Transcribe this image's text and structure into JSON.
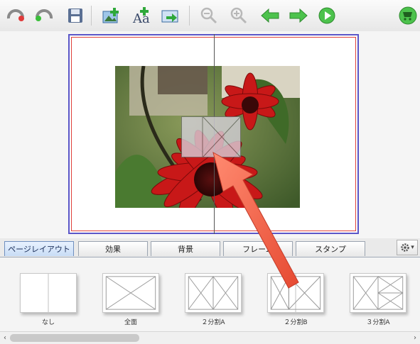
{
  "toolbar": {
    "buttons": [
      {
        "icon": "undo-icon"
      },
      {
        "icon": "redo-icon"
      },
      {
        "icon": "save-icon"
      },
      {
        "icon": "add-photo-icon"
      },
      {
        "icon": "add-text-icon"
      },
      {
        "icon": "add-image-icon"
      },
      {
        "icon": "zoom-out-icon"
      },
      {
        "icon": "zoom-in-icon"
      },
      {
        "icon": "back-arrow-icon"
      },
      {
        "icon": "forward-arrow-icon"
      },
      {
        "icon": "play-icon"
      },
      {
        "icon": "cart-icon"
      }
    ]
  },
  "tabs": [
    {
      "label": "ページレイアウト",
      "active": true
    },
    {
      "label": "効果"
    },
    {
      "label": "背景"
    },
    {
      "label": "フレーム"
    },
    {
      "label": "スタンプ"
    }
  ],
  "settings": {
    "icon": "gear-icon",
    "caret": "▾"
  },
  "layouts": [
    {
      "label": "なし"
    },
    {
      "label": "全面"
    },
    {
      "label": "２分割A"
    },
    {
      "label": "２分割B"
    },
    {
      "label": "３分割A"
    }
  ],
  "scrollbar": {
    "left_arrow": "‹",
    "right_arrow": "›"
  },
  "colors": {
    "spread_border": "#5b56c8",
    "spread_inner_border": "#e0403a",
    "active_tab": "#c8dcf5",
    "annotation_arrow": "#f0604a"
  }
}
